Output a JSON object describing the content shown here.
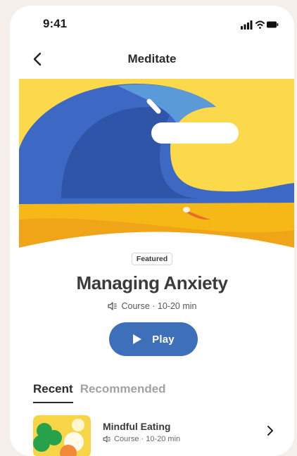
{
  "status_bar": {
    "time": "9:41"
  },
  "header": {
    "title": "Meditate"
  },
  "featured": {
    "badge": "Featured",
    "title": "Managing Anxiety",
    "meta": "Course · 10-20 min",
    "play_label": "Play"
  },
  "tabs": [
    {
      "label": "Recent"
    },
    {
      "label": "Recommended"
    }
  ],
  "list": [
    {
      "title": "Mindful Eating",
      "meta": "Course · 10-20 min"
    }
  ],
  "colors": {
    "accent": "#3e6fb9",
    "hero_sky": "#fcd94b",
    "hero_wave": "#3d69c4",
    "hero_sand": "#f6b817"
  }
}
